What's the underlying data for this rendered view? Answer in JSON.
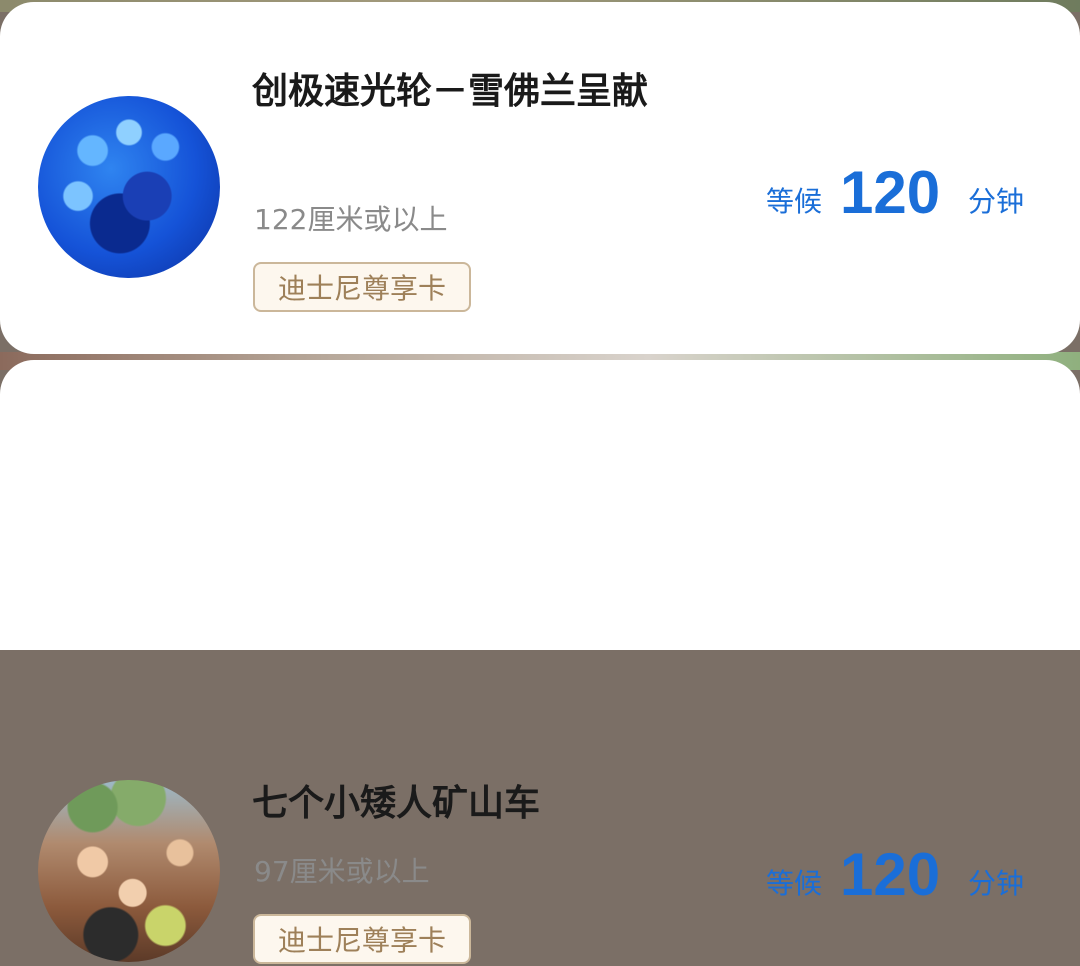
{
  "attractions": [
    {
      "name": "创极速光轮－雪佛兰呈献",
      "height": "122厘米或以上",
      "badge": "迪士尼尊享卡",
      "wait": {
        "prefix": "等候",
        "value": "120",
        "unit": "分钟"
      }
    },
    {
      "name": "七个小矮人矿山车",
      "height": "97厘米或以上",
      "badge": "迪士尼尊享卡",
      "wait": {
        "prefix": "等候",
        "value": "120",
        "unit": "分钟"
      }
    }
  ]
}
